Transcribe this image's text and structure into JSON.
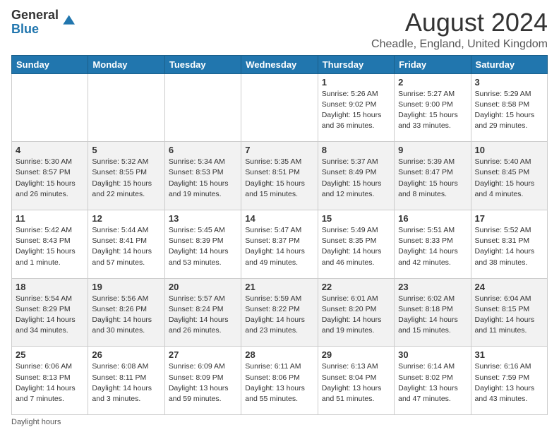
{
  "header": {
    "logo_line1": "General",
    "logo_line2": "Blue",
    "month_title": "August 2024",
    "location": "Cheadle, England, United Kingdom"
  },
  "weekdays": [
    "Sunday",
    "Monday",
    "Tuesday",
    "Wednesday",
    "Thursday",
    "Friday",
    "Saturday"
  ],
  "weeks": [
    [
      {
        "day": "",
        "info": ""
      },
      {
        "day": "",
        "info": ""
      },
      {
        "day": "",
        "info": ""
      },
      {
        "day": "",
        "info": ""
      },
      {
        "day": "1",
        "info": "Sunrise: 5:26 AM\nSunset: 9:02 PM\nDaylight: 15 hours and 36 minutes."
      },
      {
        "day": "2",
        "info": "Sunrise: 5:27 AM\nSunset: 9:00 PM\nDaylight: 15 hours and 33 minutes."
      },
      {
        "day": "3",
        "info": "Sunrise: 5:29 AM\nSunset: 8:58 PM\nDaylight: 15 hours and 29 minutes."
      }
    ],
    [
      {
        "day": "4",
        "info": "Sunrise: 5:30 AM\nSunset: 8:57 PM\nDaylight: 15 hours and 26 minutes."
      },
      {
        "day": "5",
        "info": "Sunrise: 5:32 AM\nSunset: 8:55 PM\nDaylight: 15 hours and 22 minutes."
      },
      {
        "day": "6",
        "info": "Sunrise: 5:34 AM\nSunset: 8:53 PM\nDaylight: 15 hours and 19 minutes."
      },
      {
        "day": "7",
        "info": "Sunrise: 5:35 AM\nSunset: 8:51 PM\nDaylight: 15 hours and 15 minutes."
      },
      {
        "day": "8",
        "info": "Sunrise: 5:37 AM\nSunset: 8:49 PM\nDaylight: 15 hours and 12 minutes."
      },
      {
        "day": "9",
        "info": "Sunrise: 5:39 AM\nSunset: 8:47 PM\nDaylight: 15 hours and 8 minutes."
      },
      {
        "day": "10",
        "info": "Sunrise: 5:40 AM\nSunset: 8:45 PM\nDaylight: 15 hours and 4 minutes."
      }
    ],
    [
      {
        "day": "11",
        "info": "Sunrise: 5:42 AM\nSunset: 8:43 PM\nDaylight: 15 hours and 1 minute."
      },
      {
        "day": "12",
        "info": "Sunrise: 5:44 AM\nSunset: 8:41 PM\nDaylight: 14 hours and 57 minutes."
      },
      {
        "day": "13",
        "info": "Sunrise: 5:45 AM\nSunset: 8:39 PM\nDaylight: 14 hours and 53 minutes."
      },
      {
        "day": "14",
        "info": "Sunrise: 5:47 AM\nSunset: 8:37 PM\nDaylight: 14 hours and 49 minutes."
      },
      {
        "day": "15",
        "info": "Sunrise: 5:49 AM\nSunset: 8:35 PM\nDaylight: 14 hours and 46 minutes."
      },
      {
        "day": "16",
        "info": "Sunrise: 5:51 AM\nSunset: 8:33 PM\nDaylight: 14 hours and 42 minutes."
      },
      {
        "day": "17",
        "info": "Sunrise: 5:52 AM\nSunset: 8:31 PM\nDaylight: 14 hours and 38 minutes."
      }
    ],
    [
      {
        "day": "18",
        "info": "Sunrise: 5:54 AM\nSunset: 8:29 PM\nDaylight: 14 hours and 34 minutes."
      },
      {
        "day": "19",
        "info": "Sunrise: 5:56 AM\nSunset: 8:26 PM\nDaylight: 14 hours and 30 minutes."
      },
      {
        "day": "20",
        "info": "Sunrise: 5:57 AM\nSunset: 8:24 PM\nDaylight: 14 hours and 26 minutes."
      },
      {
        "day": "21",
        "info": "Sunrise: 5:59 AM\nSunset: 8:22 PM\nDaylight: 14 hours and 23 minutes."
      },
      {
        "day": "22",
        "info": "Sunrise: 6:01 AM\nSunset: 8:20 PM\nDaylight: 14 hours and 19 minutes."
      },
      {
        "day": "23",
        "info": "Sunrise: 6:02 AM\nSunset: 8:18 PM\nDaylight: 14 hours and 15 minutes."
      },
      {
        "day": "24",
        "info": "Sunrise: 6:04 AM\nSunset: 8:15 PM\nDaylight: 14 hours and 11 minutes."
      }
    ],
    [
      {
        "day": "25",
        "info": "Sunrise: 6:06 AM\nSunset: 8:13 PM\nDaylight: 14 hours and 7 minutes."
      },
      {
        "day": "26",
        "info": "Sunrise: 6:08 AM\nSunset: 8:11 PM\nDaylight: 14 hours and 3 minutes."
      },
      {
        "day": "27",
        "info": "Sunrise: 6:09 AM\nSunset: 8:09 PM\nDaylight: 13 hours and 59 minutes."
      },
      {
        "day": "28",
        "info": "Sunrise: 6:11 AM\nSunset: 8:06 PM\nDaylight: 13 hours and 55 minutes."
      },
      {
        "day": "29",
        "info": "Sunrise: 6:13 AM\nSunset: 8:04 PM\nDaylight: 13 hours and 51 minutes."
      },
      {
        "day": "30",
        "info": "Sunrise: 6:14 AM\nSunset: 8:02 PM\nDaylight: 13 hours and 47 minutes."
      },
      {
        "day": "31",
        "info": "Sunrise: 6:16 AM\nSunset: 7:59 PM\nDaylight: 13 hours and 43 minutes."
      }
    ]
  ],
  "footer": {
    "note": "Daylight hours"
  }
}
